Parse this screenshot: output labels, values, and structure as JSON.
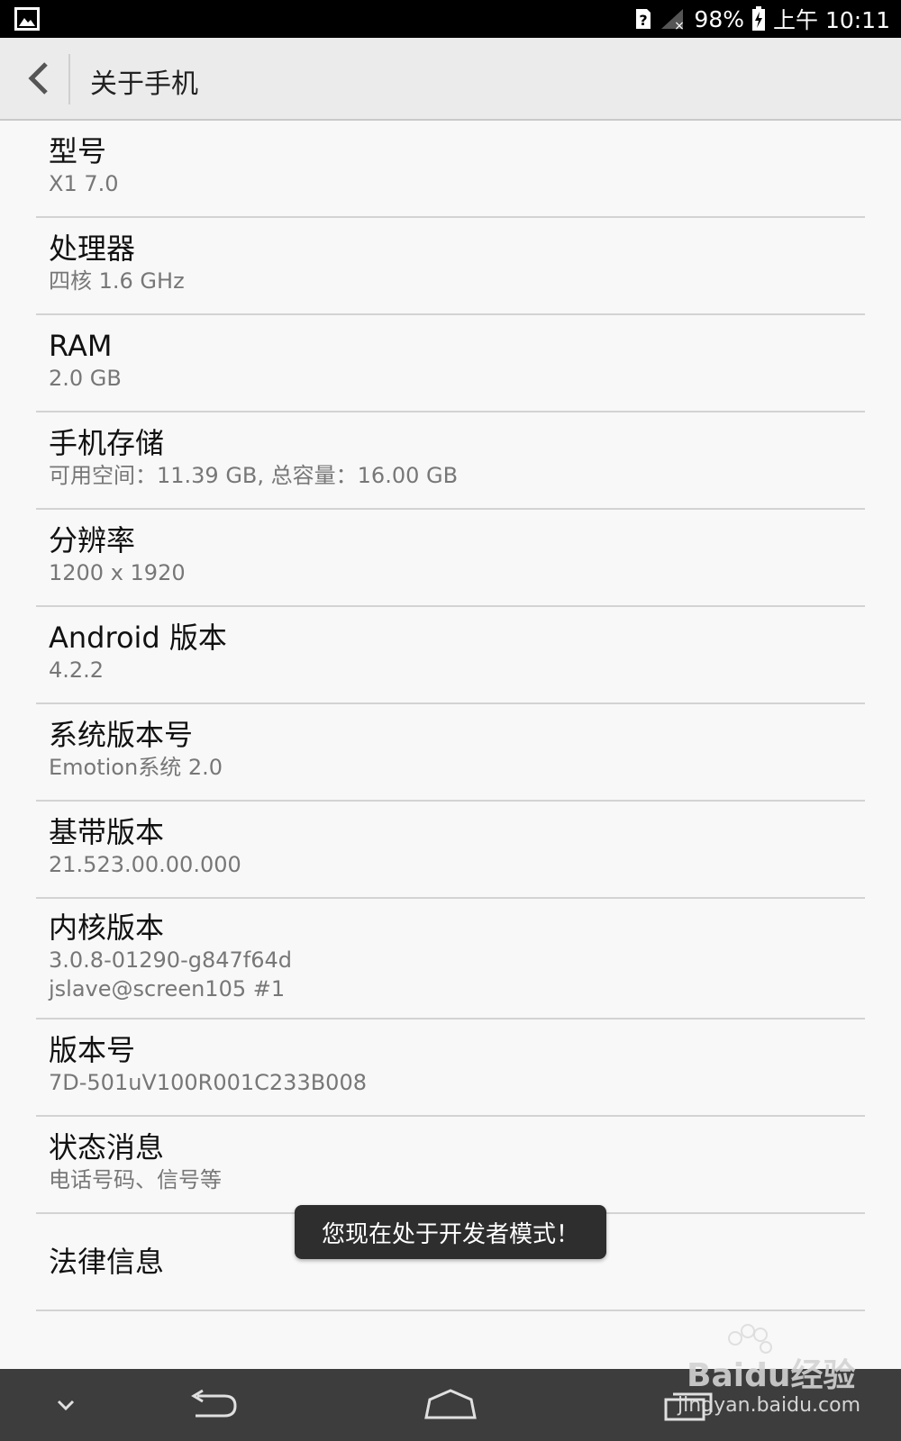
{
  "status_bar": {
    "battery_percent": "98%",
    "time": "上午 10:11",
    "icons": [
      "gallery-icon",
      "sim-unknown-icon",
      "signal-no-service-icon",
      "battery-charging-icon"
    ]
  },
  "action_bar": {
    "title": "关于手机",
    "back_icon": "chevron-left-icon"
  },
  "items": [
    {
      "title": "型号",
      "sub": "X1 7.0"
    },
    {
      "title": "处理器",
      "sub": "四核 1.6 GHz"
    },
    {
      "title": "RAM",
      "sub": "2.0 GB"
    },
    {
      "title": "手机存储",
      "sub": "可用空间：11.39  GB, 总容量：16.00  GB"
    },
    {
      "title": "分辨率",
      "sub": "1200 x 1920"
    },
    {
      "title": "Android 版本",
      "sub": "4.2.2"
    },
    {
      "title": "系统版本号",
      "sub": "Emotion系统 2.0"
    },
    {
      "title": "基带版本",
      "sub": "21.523.00.00.000"
    },
    {
      "title": "内核版本",
      "sub": "3.0.8-01290-g847f64d",
      "sub2": "jslave@screen105 #1"
    },
    {
      "title": "版本号",
      "sub": "7D-501uV100R001C233B008"
    },
    {
      "title": "状态消息",
      "sub": "电话号码、信号等"
    },
    {
      "title": "法律信息"
    }
  ],
  "toast": {
    "text": "您现在处于开发者模式！"
  },
  "nav_bar": {
    "icons": [
      "hide-keyboard-icon",
      "back-arrow-icon",
      "home-icon",
      "recent-apps-icon"
    ]
  },
  "watermark": {
    "brand": "Baidu经验",
    "url": "jingyan.baidu.com"
  }
}
